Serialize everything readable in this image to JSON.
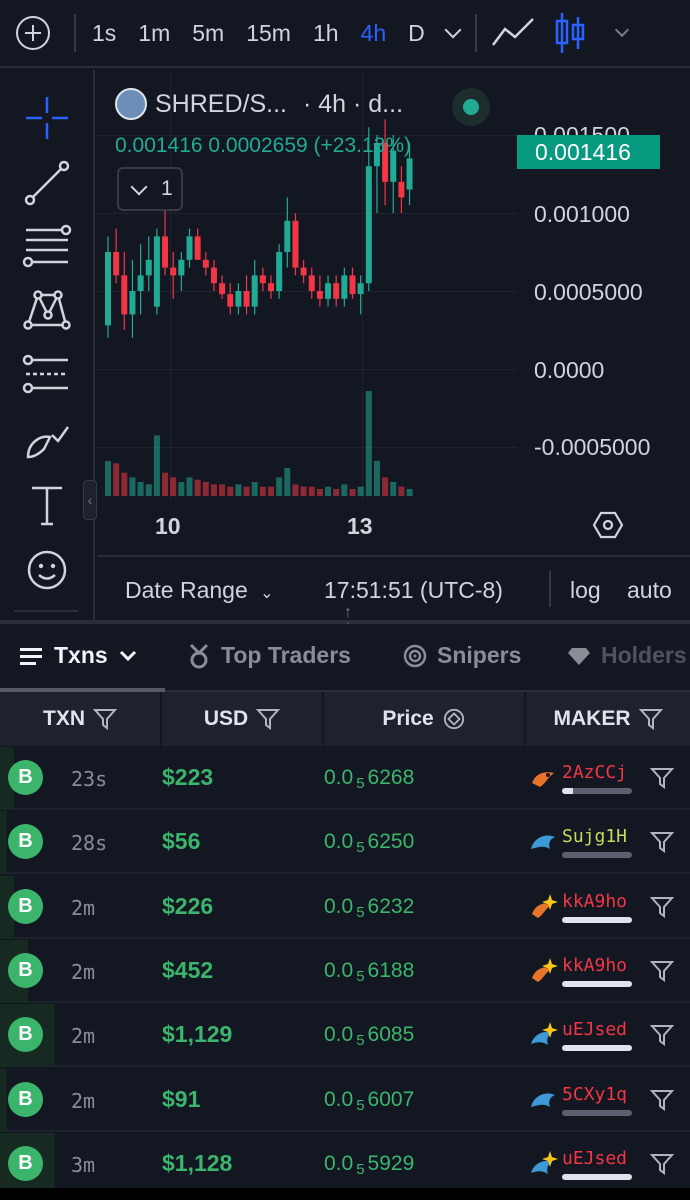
{
  "toolbar": {
    "timeframes": [
      "1s",
      "1m",
      "5m",
      "15m",
      "1h",
      "4h",
      "D"
    ],
    "active_timeframe": "4h"
  },
  "chart": {
    "pair": "SHRED/S...",
    "interval_suffix": "· 4h · d...",
    "ohlc_line": "0.001416  0.0002659  (+23.13%)",
    "indicator_count": "1",
    "last_price": "0.001416",
    "price_axis": [
      "0.001500",
      "0.001000",
      "0.0005000",
      "0.0000",
      "-0.0005000"
    ],
    "x_labels": [
      "10",
      "13"
    ],
    "colors": {
      "up": "#22ab94",
      "down": "#f23645"
    }
  },
  "chart_data": {
    "type": "candlestick",
    "title": "",
    "ylabel": "",
    "xlabel": "",
    "ylim": [
      -0.0007,
      0.0016
    ],
    "xticks": [
      "10",
      "13"
    ],
    "candles": [
      {
        "o": 0.00028,
        "h": 0.00085,
        "l": 0.0002,
        "c": 0.00075
      },
      {
        "o": 0.00075,
        "h": 0.0009,
        "l": 0.00055,
        "c": 0.0006
      },
      {
        "o": 0.0006,
        "h": 0.00075,
        "l": 0.00025,
        "c": 0.00035
      },
      {
        "o": 0.00035,
        "h": 0.0007,
        "l": 0.0002,
        "c": 0.0005
      },
      {
        "o": 0.0005,
        "h": 0.0008,
        "l": 0.00035,
        "c": 0.0006
      },
      {
        "o": 0.0006,
        "h": 0.00085,
        "l": 0.0005,
        "c": 0.0007
      },
      {
        "o": 0.0004,
        "h": 0.0009,
        "l": 0.00035,
        "c": 0.00085
      },
      {
        "o": 0.00085,
        "h": 0.00105,
        "l": 0.0006,
        "c": 0.00065
      },
      {
        "o": 0.00065,
        "h": 0.00075,
        "l": 0.00045,
        "c": 0.0006
      },
      {
        "o": 0.0006,
        "h": 0.00075,
        "l": 0.0005,
        "c": 0.0007
      },
      {
        "o": 0.0007,
        "h": 0.0009,
        "l": 0.00065,
        "c": 0.00085
      },
      {
        "o": 0.00085,
        "h": 0.0009,
        "l": 0.0007,
        "c": 0.0007
      },
      {
        "o": 0.0007,
        "h": 0.00075,
        "l": 0.0006,
        "c": 0.00065
      },
      {
        "o": 0.00065,
        "h": 0.0007,
        "l": 0.0005,
        "c": 0.00055
      },
      {
        "o": 0.00055,
        "h": 0.0006,
        "l": 0.00045,
        "c": 0.00048
      },
      {
        "o": 0.00048,
        "h": 0.00055,
        "l": 0.00035,
        "c": 0.0004
      },
      {
        "o": 0.0004,
        "h": 0.00055,
        "l": 0.00035,
        "c": 0.0005
      },
      {
        "o": 0.0005,
        "h": 0.0006,
        "l": 0.00035,
        "c": 0.0004
      },
      {
        "o": 0.0004,
        "h": 0.0007,
        "l": 0.00035,
        "c": 0.0006
      },
      {
        "o": 0.0006,
        "h": 0.00065,
        "l": 0.0005,
        "c": 0.00055
      },
      {
        "o": 0.00055,
        "h": 0.0006,
        "l": 0.00045,
        "c": 0.0005
      },
      {
        "o": 0.0005,
        "h": 0.0008,
        "l": 0.00045,
        "c": 0.00075
      },
      {
        "o": 0.00075,
        "h": 0.0011,
        "l": 0.00065,
        "c": 0.00095
      },
      {
        "o": 0.00095,
        "h": 0.001,
        "l": 0.0006,
        "c": 0.00065
      },
      {
        "o": 0.00065,
        "h": 0.0007,
        "l": 0.00055,
        "c": 0.0006
      },
      {
        "o": 0.0006,
        "h": 0.00065,
        "l": 0.00045,
        "c": 0.0005
      },
      {
        "o": 0.0005,
        "h": 0.0006,
        "l": 0.0004,
        "c": 0.00045
      },
      {
        "o": 0.00045,
        "h": 0.0006,
        "l": 0.0004,
        "c": 0.00055
      },
      {
        "o": 0.00055,
        "h": 0.0006,
        "l": 0.0004,
        "c": 0.00045
      },
      {
        "o": 0.00045,
        "h": 0.00065,
        "l": 0.0004,
        "c": 0.0006
      },
      {
        "o": 0.0006,
        "h": 0.00065,
        "l": 0.00045,
        "c": 0.00048
      },
      {
        "o": 0.00048,
        "h": 0.0006,
        "l": 0.00035,
        "c": 0.00055
      },
      {
        "o": 0.00055,
        "h": 0.00155,
        "l": 0.0005,
        "c": 0.0013
      },
      {
        "o": 0.0013,
        "h": 0.0015,
        "l": 0.001,
        "c": 0.00145
      },
      {
        "o": 0.00145,
        "h": 0.0016,
        "l": 0.00105,
        "c": 0.0012
      },
      {
        "o": 0.0012,
        "h": 0.0015,
        "l": 0.001,
        "c": 0.0014
      },
      {
        "o": 0.0012,
        "h": 0.0013,
        "l": 0.001,
        "c": 0.0011
      },
      {
        "o": 0.00115,
        "h": 0.00145,
        "l": 0.00105,
        "c": 0.00135
      }
    ],
    "volume": [
      15,
      14,
      10,
      8,
      6,
      5,
      26,
      10,
      8,
      6,
      8,
      7,
      6,
      5,
      5,
      4,
      5,
      4,
      6,
      4,
      4,
      8,
      12,
      5,
      4,
      4,
      3,
      4,
      3,
      5,
      3,
      4,
      45,
      15,
      8,
      6,
      4,
      3
    ]
  },
  "chart_footer": {
    "date_range": "Date Range",
    "time": "17:51:51 (UTC-8)",
    "log": "log",
    "auto": "auto"
  },
  "tabs": [
    "Txns",
    "Top Traders",
    "Snipers",
    "Holders"
  ],
  "table": {
    "columns": [
      "TXN",
      "USD",
      "Price",
      "MAKER"
    ],
    "type_badge": "B",
    "rows": [
      {
        "age": "23s",
        "usd": "$223",
        "price_head": "0.0",
        "price_sub": "5",
        "price_tail": "6268",
        "maker": "2AzCCj",
        "maker_color": "#f23645",
        "icon": "bird-icon",
        "vol": 0.02,
        "maker_fill": 0.15
      },
      {
        "age": "28s",
        "usd": "$56",
        "price_head": "0.0",
        "price_sub": "5",
        "price_tail": "6250",
        "maker": "Sujg1H",
        "maker_color": "#c8d85a",
        "icon": "dolphin-icon",
        "vol": 0.01,
        "maker_fill": 0.0
      },
      {
        "age": "2m",
        "usd": "$226",
        "price_head": "0.0",
        "price_sub": "5",
        "price_tail": "6232",
        "maker": "kkA9ho",
        "maker_color": "#f23645",
        "icon": "sparkle-bird-icon",
        "vol": 0.02,
        "maker_fill": 1.0
      },
      {
        "age": "2m",
        "usd": "$452",
        "price_head": "0.0",
        "price_sub": "5",
        "price_tail": "6188",
        "maker": "kkA9ho",
        "maker_color": "#f23645",
        "icon": "sparkle-bird-icon",
        "vol": 0.04,
        "maker_fill": 1.0
      },
      {
        "age": "2m",
        "usd": "$1,129",
        "price_head": "0.0",
        "price_sub": "5",
        "price_tail": "6085",
        "maker": "uEJsed",
        "maker_color": "#f23645",
        "icon": "sparkle-dolphin-icon",
        "vol": 0.08,
        "maker_fill": 1.0
      },
      {
        "age": "2m",
        "usd": "$91",
        "price_head": "0.0",
        "price_sub": "5",
        "price_tail": "6007",
        "maker": "5CXy1q",
        "maker_color": "#f23645",
        "icon": "dolphin-icon",
        "vol": 0.01,
        "maker_fill": 0.0
      },
      {
        "age": "3m",
        "usd": "$1,128",
        "price_head": "0.0",
        "price_sub": "5",
        "price_tail": "5929",
        "maker": "uEJsed",
        "maker_color": "#f23645",
        "icon": "sparkle-dolphin-icon",
        "vol": 0.08,
        "maker_fill": 1.0
      }
    ]
  }
}
